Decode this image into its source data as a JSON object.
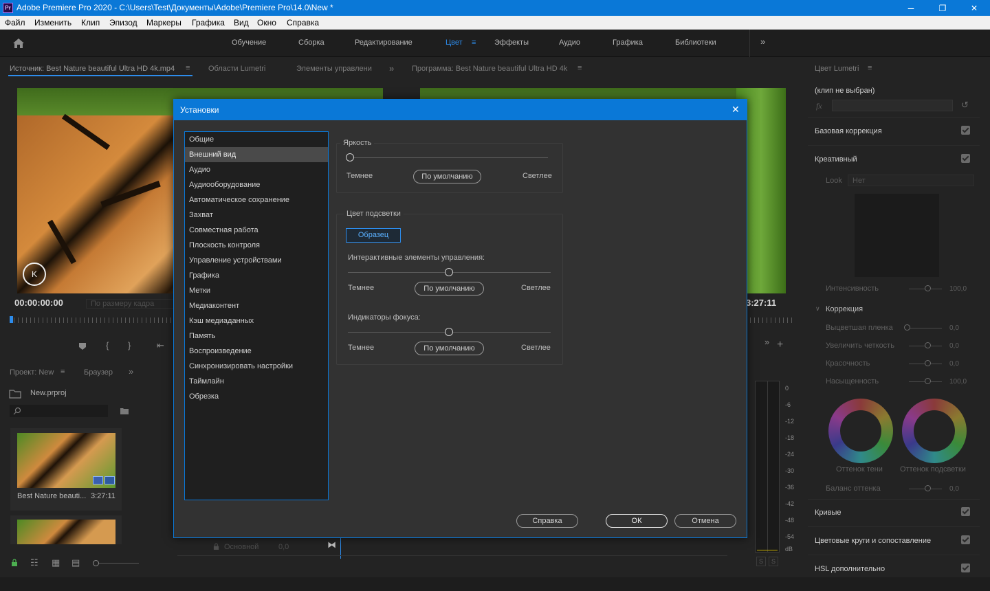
{
  "window": {
    "app_icon_text": "Pr",
    "title": "Adobe Premiere Pro 2020 - C:\\Users\\Test\\Документы\\Adobe\\Premiere Pro\\14.0\\New *",
    "minimize": "─",
    "maximize": "❐",
    "close": "✕"
  },
  "menu": [
    "Файл",
    "Изменить",
    "Клип",
    "Эпизод",
    "Маркеры",
    "Графика",
    "Вид",
    "Окно",
    "Справка"
  ],
  "workspaces": {
    "items": [
      "Обучение",
      "Сборка",
      "Редактирование",
      "Цвет",
      "Эффекты",
      "Аудио",
      "Графика",
      "Библиотеки"
    ],
    "active": "Цвет",
    "more": "»",
    "menu_icon": "≡"
  },
  "source_panel": {
    "tab_source": "Источник: Best Nature beautiful Ultra HD 4k.mp4",
    "tab_scopes": "Области Lumetri",
    "tab_controls": "Элементы управлени",
    "more": "»",
    "timecode": "00:00:00:00",
    "fit": "По размеру кадра"
  },
  "program_panel": {
    "tab": "Программа: Best Nature beautiful Ultra HD 4k",
    "timecode": "3:27:11",
    "more": "»",
    "add": "+"
  },
  "project_panel": {
    "tab_project": "Проект: New",
    "tab_browser": "Браузер",
    "more": "»",
    "file": "New.prproj",
    "clip_name": "Best Nature beauti...",
    "clip_duration": "3:27:11"
  },
  "timeline": {
    "track_name": "Основной",
    "track_value": "0,0"
  },
  "meter": {
    "labels": [
      "0",
      "-6",
      "-12",
      "-18",
      "-24",
      "-30",
      "-36",
      "-42",
      "-48",
      "-54",
      "dB"
    ],
    "solo": [
      "S",
      "S"
    ]
  },
  "lumetri": {
    "tab": "Цвет Lumetri",
    "no_clip": "(клип не выбран)",
    "fx": "fx",
    "sections": {
      "basic": "Базовая коррекция",
      "creative": "Креативный",
      "curves": "Кривые",
      "wheels": "Цветовые круги и сопоставление",
      "hsl": "HSL дополнительно"
    },
    "look_label": "Look",
    "look_value": "Нет",
    "intensity": {
      "label": "Интенсивность",
      "value": "100,0"
    },
    "correction": "Коррекция",
    "rows": [
      {
        "label": "Выцветшая пленка",
        "value": "0,0"
      },
      {
        "label": "Увеличить четкость",
        "value": "0,0"
      },
      {
        "label": "Красочность",
        "value": "0,0"
      },
      {
        "label": "Насыщенность",
        "value": "100,0"
      }
    ],
    "shadow_tint": "Оттенок тени",
    "highlight_tint": "Оттенок подсветки",
    "tint_balance": {
      "label": "Баланс оттенка",
      "value": "0,0"
    }
  },
  "dialog": {
    "title": "Установки",
    "close": "✕",
    "categories": [
      "Общие",
      "Внешний вид",
      "Аудио",
      "Аудиооборудование",
      "Автоматическое сохранение",
      "Захват",
      "Совместная работа",
      "Плоскость контроля",
      "Управление устройствами",
      "Графика",
      "Метки",
      "Медиаконтент",
      "Кэш медиаданных",
      "Память",
      "Воспроизведение",
      "Синхронизировать настройки",
      "Таймлайн",
      "Обрезка"
    ],
    "selected_category": "Внешний вид",
    "brightness": {
      "label": "Яркость",
      "darker": "Темнее",
      "default": "По умолчанию",
      "lighter": "Светлее"
    },
    "highlight": {
      "label": "Цвет подсветки",
      "sample": "Образец",
      "interactive_label": "Интерактивные элементы управления:",
      "focus_label": "Индикаторы фокуса:",
      "darker": "Темнее",
      "default": "По умолчанию",
      "lighter": "Светлее"
    },
    "buttons": {
      "help": "Справка",
      "ok": "ОК",
      "cancel": "Отмена"
    }
  }
}
